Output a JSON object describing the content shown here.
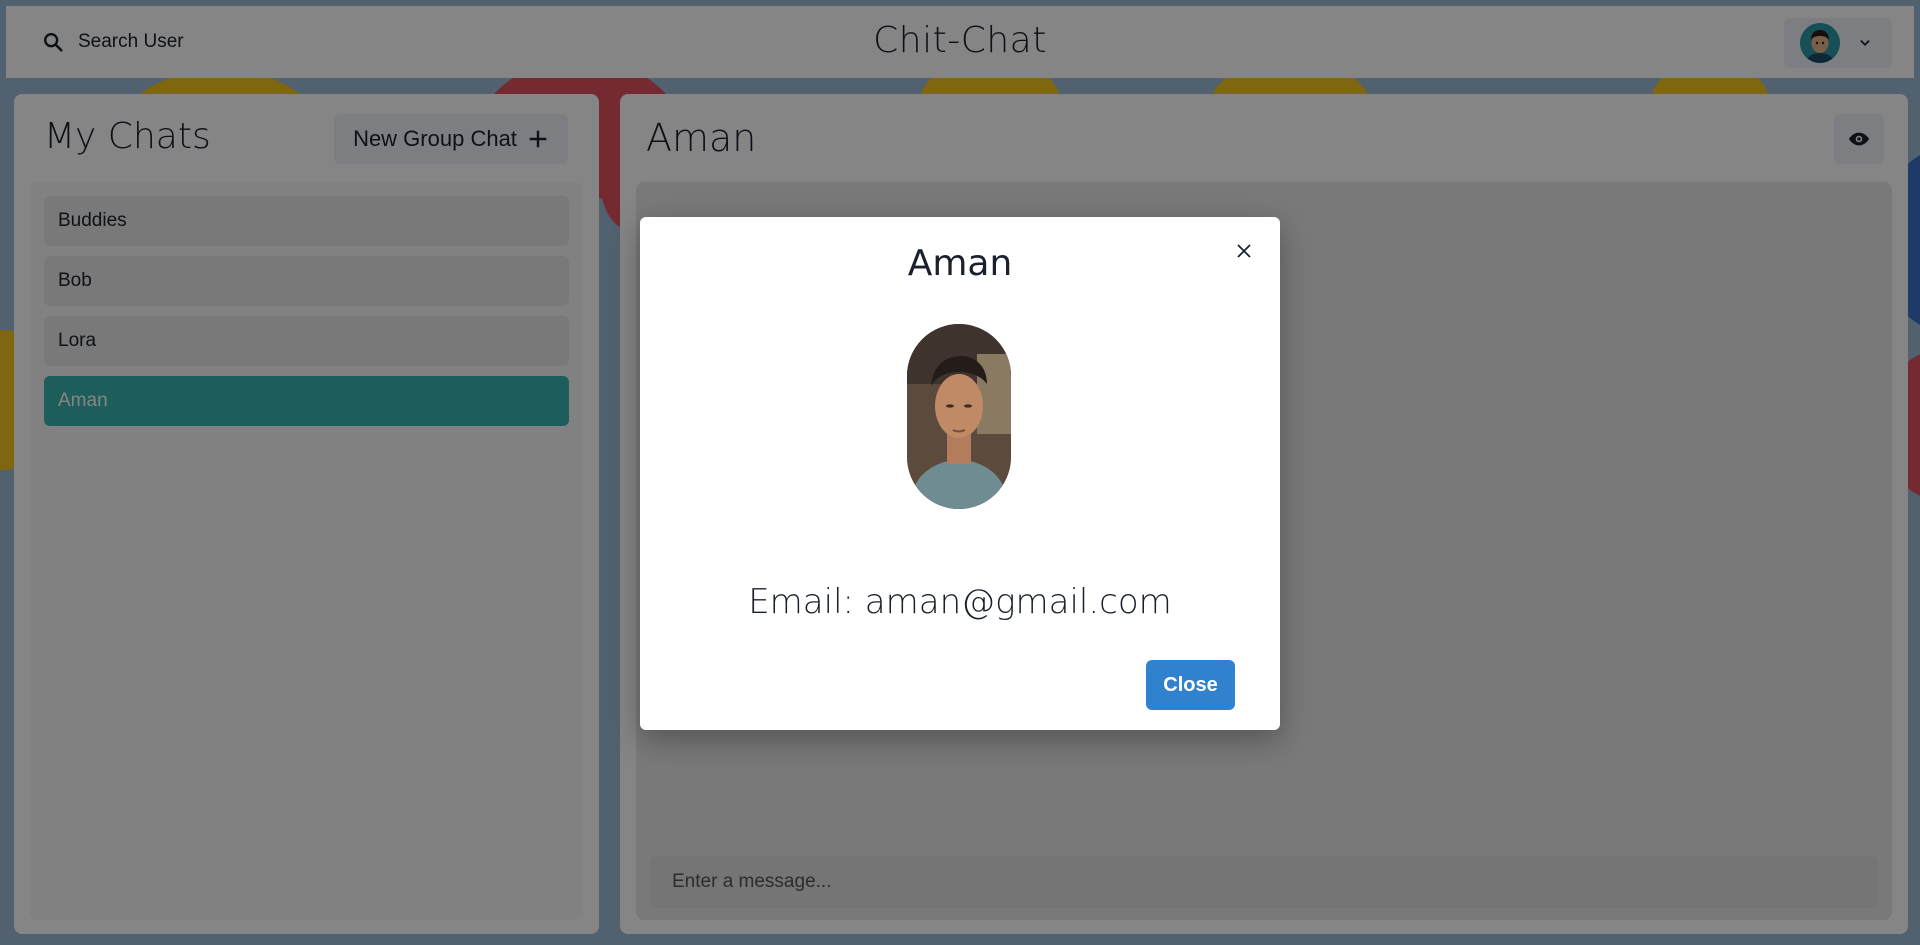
{
  "header": {
    "search_label": "Search User",
    "app_title": "Chit-Chat"
  },
  "sidebar": {
    "title": "My Chats",
    "new_group_label": "New Group Chat",
    "chats": [
      {
        "name": "Buddies",
        "active": false
      },
      {
        "name": "Bob",
        "active": false
      },
      {
        "name": "Lora",
        "active": false
      },
      {
        "name": "Aman",
        "active": true
      }
    ]
  },
  "conversation": {
    "title": "Aman",
    "message_placeholder": "Enter a message..."
  },
  "modal": {
    "title": "Aman",
    "email": "Email: aman@gmail.com",
    "close_label": "Close"
  },
  "colors": {
    "active_chat": "#38b2ac",
    "primary_button": "#3182ce"
  },
  "icons": [
    "search-icon",
    "bell-icon",
    "avatar-icon",
    "chevron-down-icon",
    "plus-icon",
    "eye-icon",
    "close-icon"
  ]
}
